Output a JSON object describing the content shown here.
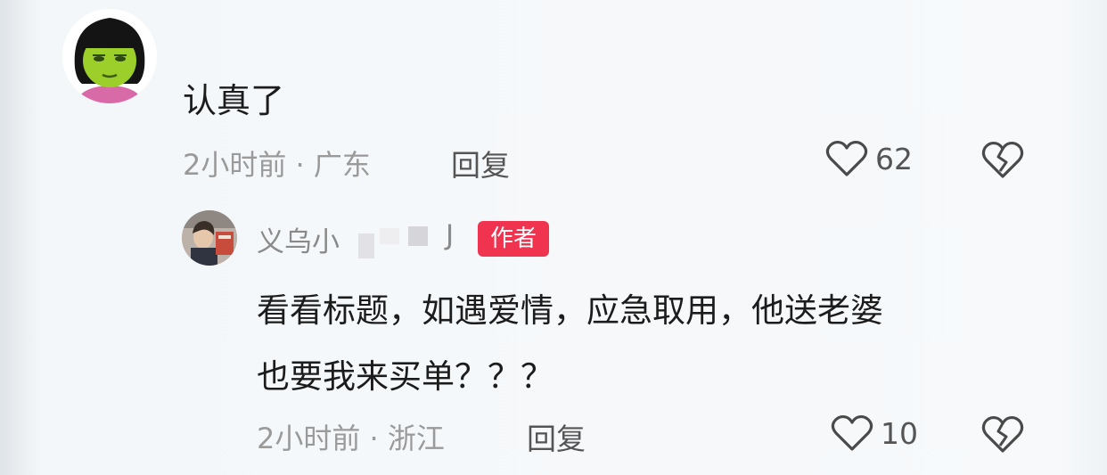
{
  "comment": {
    "avatar_icon": "green-face-girl-avatar-icon",
    "text": "认真了",
    "meta": "2小时前 · 广东",
    "reply_label": "回复",
    "like_count": "62"
  },
  "reply": {
    "avatar_icon": "photo-avatar-icon",
    "username": "义乌小",
    "username_tail": "J",
    "badge": "作者",
    "text_line1": "看看标题，如遇爱情，应急取用，他送老婆",
    "text_line2": "也要我来买单？？？",
    "meta": "2小时前 · 浙江",
    "reply_label": "回复",
    "like_count": "10"
  },
  "colors": {
    "badge": "#f0344f",
    "meta_text": "#9a9a9a",
    "body_text": "#1c1c1c"
  }
}
